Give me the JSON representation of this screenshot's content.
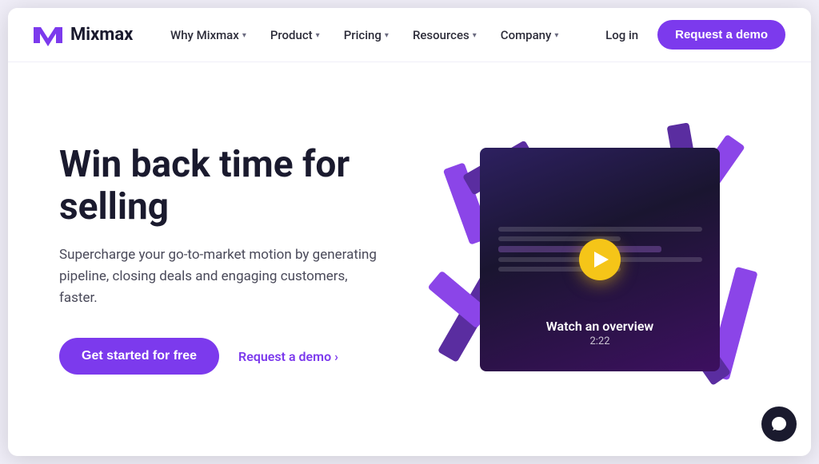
{
  "brand": {
    "name": "Mixmax",
    "logo_text": "Mixmax"
  },
  "nav": {
    "items": [
      {
        "label": "Why Mixmax",
        "has_dropdown": true
      },
      {
        "label": "Product",
        "has_dropdown": true
      },
      {
        "label": "Pricing",
        "has_dropdown": true
      },
      {
        "label": "Resources",
        "has_dropdown": true
      },
      {
        "label": "Company",
        "has_dropdown": true
      }
    ],
    "login_label": "Log in",
    "demo_label": "Request a demo"
  },
  "hero": {
    "title": "Win back time for selling",
    "subtitle": "Supercharge your go-to-market motion by generating pipeline, closing deals and engaging customers, faster.",
    "cta_primary": "Get started for free",
    "cta_secondary": "Request a demo",
    "cta_secondary_arrow": "›"
  },
  "video": {
    "watch_label": "Watch an overview",
    "duration": "2:22"
  },
  "chat": {
    "label": "Chat support"
  }
}
